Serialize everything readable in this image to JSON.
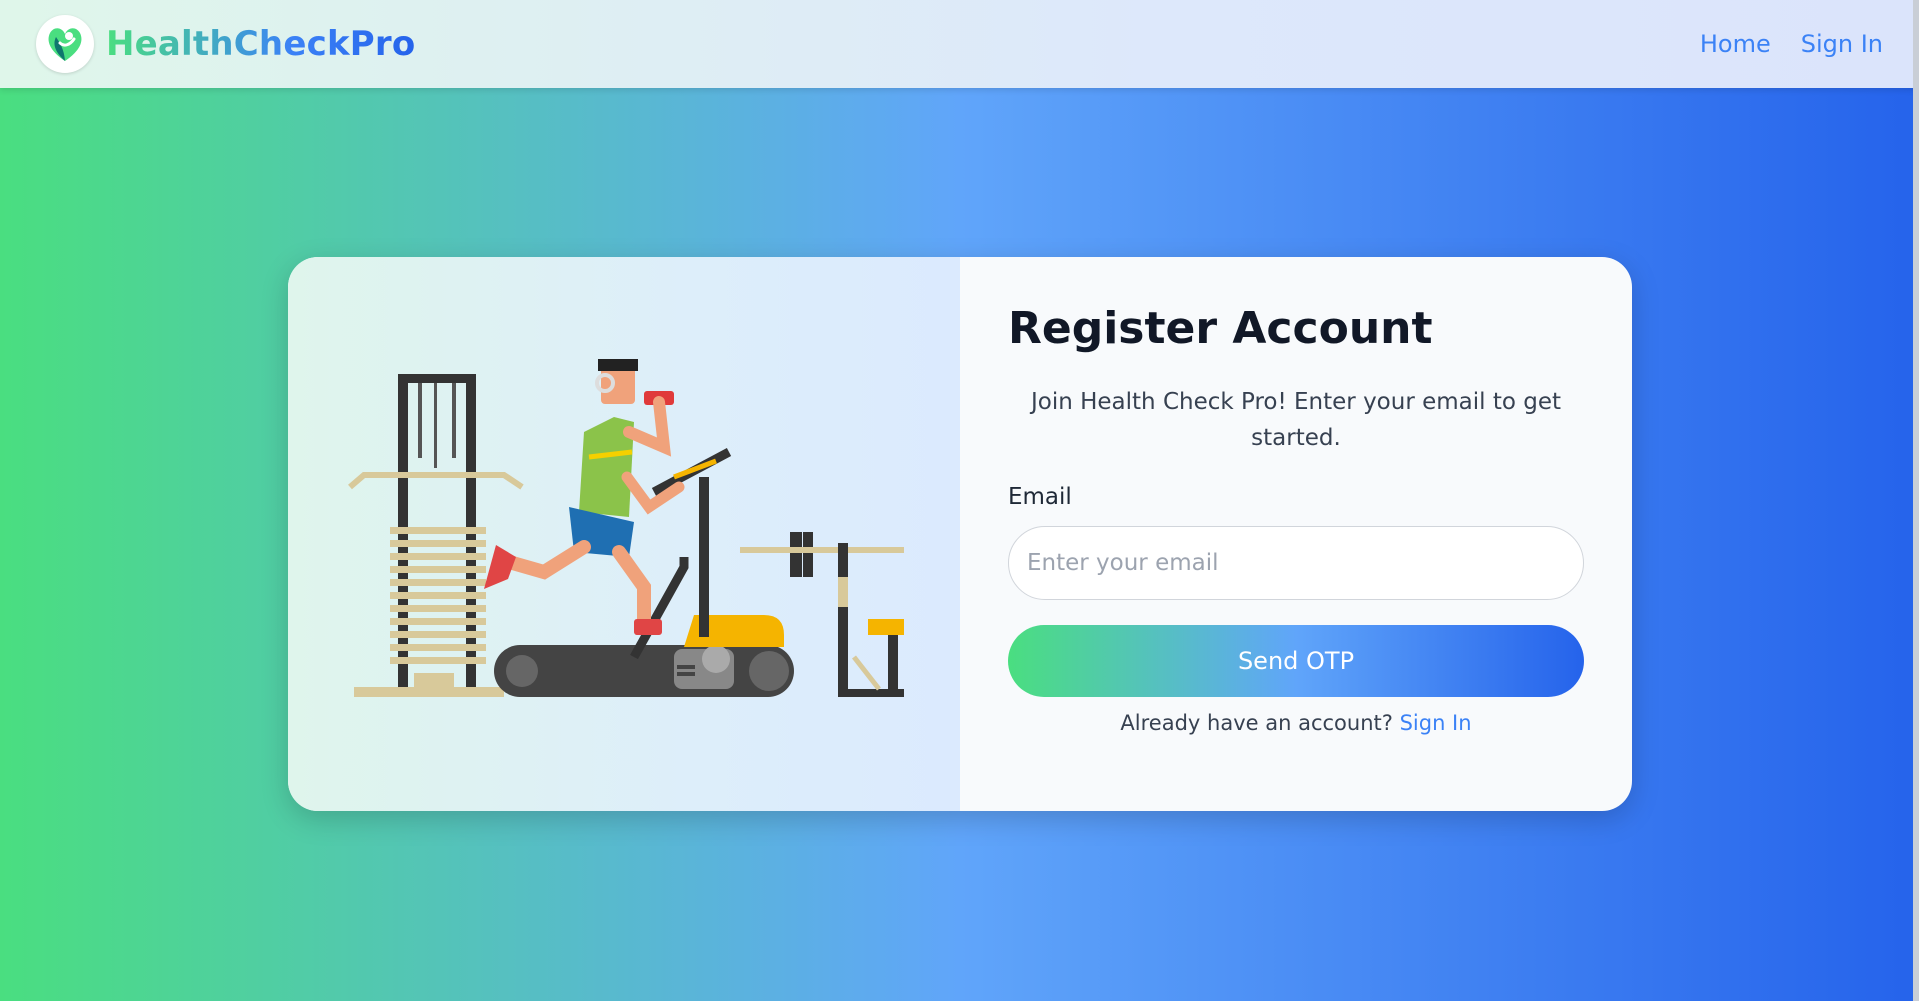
{
  "header": {
    "brand": "HealthCheckPro",
    "logo_icon": "heart-leaf-icon",
    "nav": [
      {
        "label": "Home"
      },
      {
        "label": "Sign In"
      }
    ]
  },
  "colors": {
    "gradient_start": "#4ade80",
    "gradient_mid": "#60a5fa",
    "gradient_end": "#2563eb",
    "link": "#3b82f6"
  },
  "illustration": {
    "icon": "treadmill-runner-illustration"
  },
  "form": {
    "title": "Register Account",
    "subtitle": "Join Health Check Pro! Enter your email to get started.",
    "email_label": "Email",
    "email_placeholder": "Enter your email",
    "email_value": "",
    "submit_label": "Send OTP",
    "already_text": "Already have an account?",
    "signin_link": "Sign In"
  }
}
